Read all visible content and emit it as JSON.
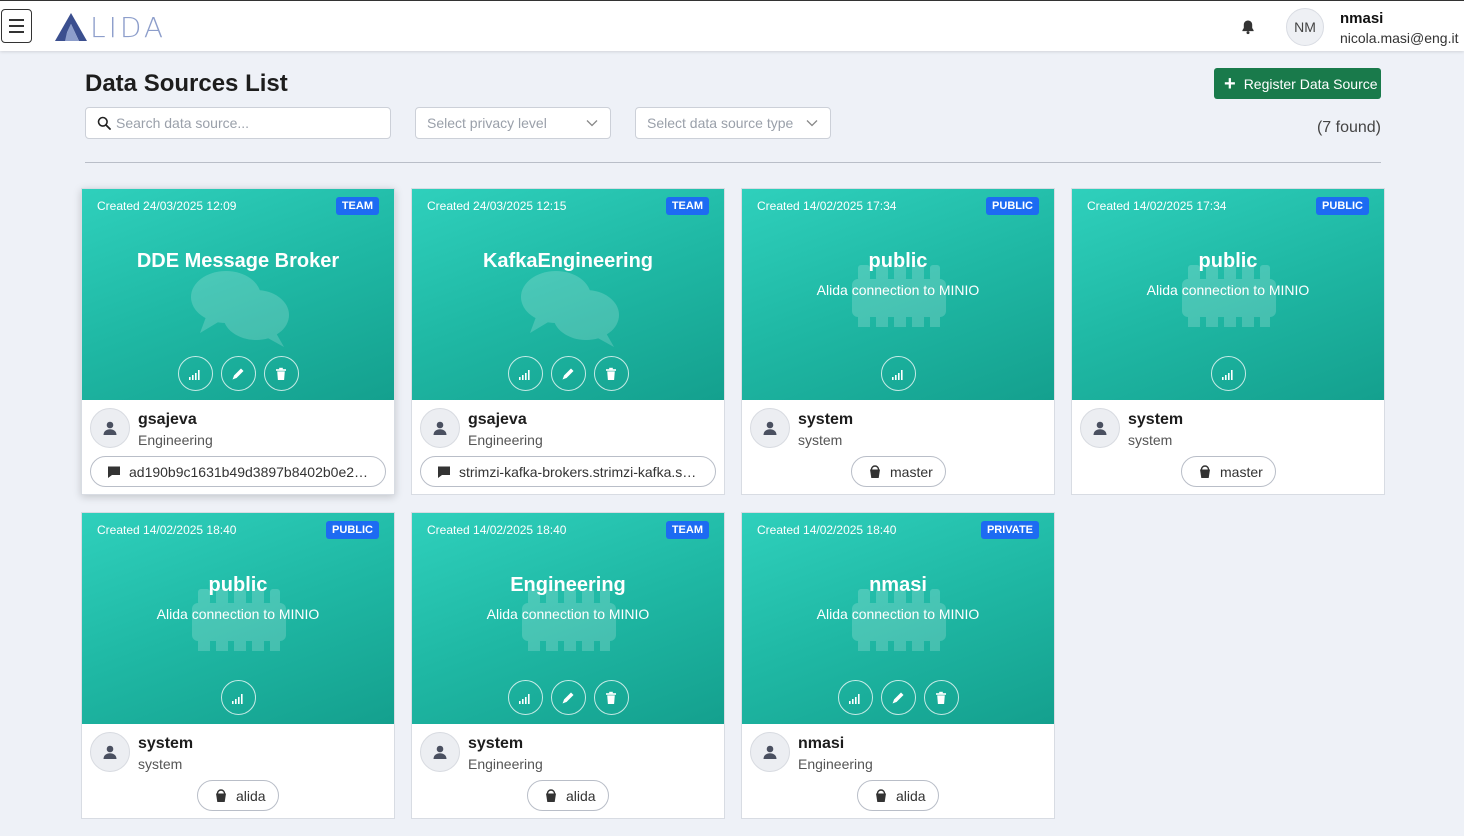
{
  "app": {
    "logo_text": "LIDA",
    "logo_letter": "A"
  },
  "user": {
    "initials": "NM",
    "name": "nmasi",
    "email": "nicola.masi@eng.it"
  },
  "page": {
    "title": "Data Sources List",
    "register_label": "Register Data Source",
    "search_placeholder": "Search data source...",
    "privacy_placeholder": "Select privacy level",
    "type_placeholder": "Select data source type",
    "found_text": "(7 found)"
  },
  "colors": {
    "accent_green": "#197a4b",
    "card_teal": "#1fb8a4",
    "badge_blue": "#1d6bf2"
  },
  "cards": [
    {
      "created": "Created 24/03/2025 12:09",
      "badge": "TEAM",
      "title": "DDE Message Broker",
      "description": "",
      "icon": "chat-icon",
      "owner": "gsajeva",
      "team": "Engineering",
      "chip": "ad190b9c1631b49d3897b8402b0e24c...",
      "chip_icon": "message-icon",
      "actions": [
        "stats",
        "edit",
        "delete"
      ]
    },
    {
      "created": "Created 24/03/2025 12:15",
      "badge": "TEAM",
      "title": "KafkaEngineering",
      "description": "",
      "icon": "chat-icon",
      "owner": "gsajeva",
      "team": "Engineering",
      "chip": "strimzi-kafka-brokers.strimzi-kafka.svc...",
      "chip_icon": "message-icon",
      "actions": [
        "stats",
        "edit",
        "delete"
      ]
    },
    {
      "created": "Created 14/02/2025 17:34",
      "badge": "PUBLIC",
      "title": "public",
      "description": "Alida connection to MINIO",
      "icon": "storage-icon",
      "owner": "system",
      "team": "system",
      "chip": "master",
      "chip_icon": "bucket-icon",
      "actions": [
        "stats"
      ]
    },
    {
      "created": "Created 14/02/2025 17:34",
      "badge": "PUBLIC",
      "title": "public",
      "description": "Alida connection to MINIO",
      "icon": "storage-icon",
      "owner": "system",
      "team": "system",
      "chip": "master",
      "chip_icon": "bucket-icon",
      "actions": [
        "stats"
      ]
    },
    {
      "created": "Created 14/02/2025 18:40",
      "badge": "PUBLIC",
      "title": "public",
      "description": "Alida connection to MINIO",
      "icon": "storage-icon",
      "owner": "system",
      "team": "system",
      "chip": "alida",
      "chip_icon": "bucket-icon",
      "actions": [
        "stats"
      ]
    },
    {
      "created": "Created 14/02/2025 18:40",
      "badge": "TEAM",
      "title": "Engineering",
      "description": "Alida connection to MINIO",
      "icon": "storage-icon",
      "owner": "system",
      "team": "Engineering",
      "chip": "alida",
      "chip_icon": "bucket-icon",
      "actions": [
        "stats",
        "edit",
        "delete"
      ]
    },
    {
      "created": "Created 14/02/2025 18:40",
      "badge": "PRIVATE",
      "title": "nmasi",
      "description": "Alida connection to MINIO",
      "icon": "storage-icon",
      "owner": "nmasi",
      "team": "Engineering",
      "chip": "alida",
      "chip_icon": "bucket-icon",
      "actions": [
        "stats",
        "edit",
        "delete"
      ]
    }
  ]
}
